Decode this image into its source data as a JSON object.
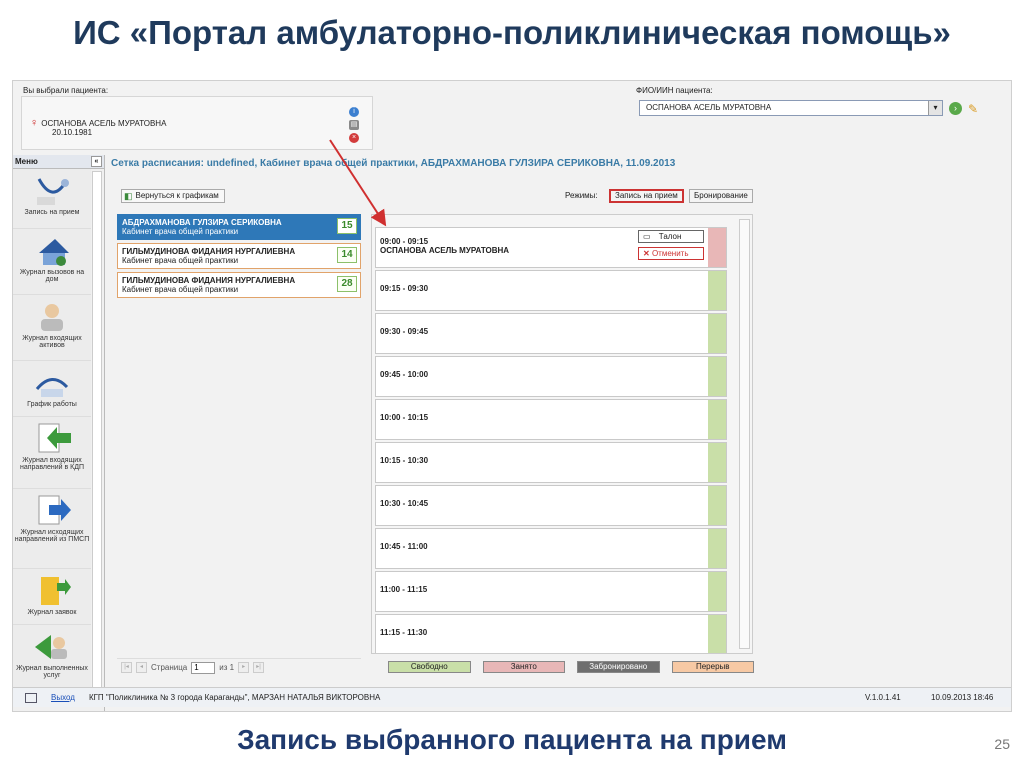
{
  "slide": {
    "title": "ИС «Портал амбулаторно-поликлиническая помощь»",
    "caption": "Запись выбранного пациента на прием",
    "page_num": "25"
  },
  "patient": {
    "selected_label": "Вы выбрали пациента:",
    "name": "ОСПАНОВА АСЕЛЬ МУРАТОВНА",
    "dob": "20.10.1981"
  },
  "fio": {
    "label": "ФИО/ИИН пациента:",
    "value": "ОСПАНОВА АСЕЛЬ МУРАТОВНА"
  },
  "menu": {
    "title": "Меню",
    "collapse": "«",
    "items": [
      {
        "label": "Запись на прием"
      },
      {
        "label": "Журнал вызовов на дом"
      },
      {
        "label": "Журнал входящих активов"
      },
      {
        "label": "График работы"
      },
      {
        "label": "Журнал входящих направлений в КДП"
      },
      {
        "label": "Журнал исходящих направлений из ПМСП"
      },
      {
        "label": "Журнал заявок"
      },
      {
        "label": "Журнал выполненных услуг"
      }
    ]
  },
  "schedule": {
    "title": "Сетка расписания: undefined, Кабинет врача общей практики, АБДРАХМАНОВА ГУЛЗИРА СЕРИКОВНА, 11.09.2013",
    "back_label": "Вернуться к графикам",
    "modes_label": "Режимы:",
    "mode_appointment": "Запись на прием",
    "mode_booking": "Бронирование"
  },
  "doctors": [
    {
      "name": "АБДРАХМАНОВА ГУЛЗИРА СЕРИКОВНА",
      "room": "Кабинет врача общей практики",
      "count": "15"
    },
    {
      "name": "ГИЛЬМУДИНОВА ФИДАНИЯ НУРГАЛИЕВНА",
      "room": "Кабинет врача общей практики",
      "count": "14"
    },
    {
      "name": "ГИЛЬМУДИНОВА ФИДАНИЯ НУРГАЛИЕВНА",
      "room": "Кабинет врача общей практики",
      "count": "28"
    }
  ],
  "pager": {
    "page_label": "Страница",
    "page": "1",
    "of_label": "из 1"
  },
  "slots": [
    {
      "time": "09:00 - 09:15",
      "patient": "ОСПАНОВА АСЕЛЬ МУРАТОВНА",
      "status": "busy"
    },
    {
      "time": "09:15 - 09:30",
      "status": "free"
    },
    {
      "time": "09:30 - 09:45",
      "status": "free"
    },
    {
      "time": "09:45 - 10:00",
      "status": "free"
    },
    {
      "time": "10:00 - 10:15",
      "status": "free"
    },
    {
      "time": "10:15 - 10:30",
      "status": "free"
    },
    {
      "time": "10:30 - 10:45",
      "status": "free"
    },
    {
      "time": "10:45 - 11:00",
      "status": "free"
    },
    {
      "time": "11:00 - 11:15",
      "status": "free"
    },
    {
      "time": "11:15 - 11:30",
      "status": "free"
    }
  ],
  "slot_actions": {
    "talon": "Талон",
    "cancel": "Отменить"
  },
  "legend": {
    "free": "Свободно",
    "busy": "Занято",
    "reserved": "Забронировано",
    "break": "Перерыв"
  },
  "colors": {
    "free": "#c9dfa8",
    "busy": "#e8b7b7",
    "reserved": "#6f6f6f",
    "break": "#f7c9a4",
    "accent": "#2e78b8",
    "arrow": "#d03030"
  },
  "status_bar": {
    "exit": "Выход",
    "org": "КГП \"Поликлиника № 3 города Караганды\", МАРЗАН НАТАЛЬЯ ВИКТОРОВНА",
    "version": "V.1.0.1.41",
    "datetime": "10.09.2013 18:46"
  }
}
